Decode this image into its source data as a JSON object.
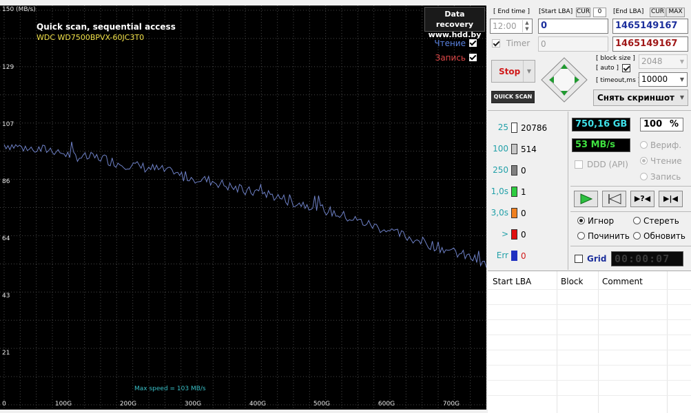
{
  "graph": {
    "y_labels": [
      {
        "text": "150 (MB/s)",
        "y": 15
      },
      {
        "text": "129",
        "y": 99
      },
      {
        "text": "107",
        "y": 182
      },
      {
        "text": "86",
        "y": 265
      },
      {
        "text": "64",
        "y": 348
      },
      {
        "text": "43",
        "y": 431
      },
      {
        "text": "21",
        "y": 514
      }
    ],
    "x_labels": [
      {
        "text": "0",
        "x": 6
      },
      {
        "text": "100G",
        "x": 92
      },
      {
        "text": "200G",
        "x": 186
      },
      {
        "text": "300G",
        "x": 280
      },
      {
        "text": "400G",
        "x": 374
      },
      {
        "text": "500G",
        "x": 467
      },
      {
        "text": "600G",
        "x": 561
      },
      {
        "text": "700G",
        "x": 655
      }
    ],
    "title": "Quick scan, sequential access",
    "model": "WDC WD7500BPVX-60JC3T0",
    "brand_line1": "Data recovery",
    "brand_line2": "www.hdd.by",
    "legend_read": "Чтение",
    "legend_write": "Запись",
    "max_speed": "Max speed = 103 MB/s",
    "colors": {
      "line": "#6f82c8",
      "grid": "#4a4a4a"
    }
  },
  "chart_data": {
    "type": "line",
    "title": "Quick scan, sequential access",
    "ylabel": "MB/s",
    "xlabel": "",
    "xlim": [
      0,
      750
    ],
    "ylim": [
      0,
      150
    ],
    "x_ticks": [
      "0",
      "100G",
      "200G",
      "300G",
      "400G",
      "500G",
      "600G",
      "700G"
    ],
    "y_ticks": [
      "21",
      "43",
      "64",
      "86",
      "107",
      "129",
      "150 (MB/s)"
    ],
    "series": [
      {
        "name": "Чтение",
        "x": [
          0,
          25,
          50,
          75,
          100,
          125,
          150,
          175,
          200,
          225,
          250,
          275,
          300,
          325,
          350,
          375,
          400,
          425,
          450,
          475,
          500,
          525,
          550,
          575,
          600,
          625,
          650,
          675,
          700,
          725,
          750
        ],
        "values": [
          99,
          98,
          97,
          97,
          95,
          94,
          94,
          92,
          91,
          90,
          89,
          87,
          86,
          85,
          83,
          81,
          81,
          79,
          77,
          76,
          74,
          72,
          70,
          68,
          66,
          64,
          62,
          60,
          58,
          56,
          53
        ]
      }
    ]
  },
  "panel": {
    "end_time_label": "[ End time ]",
    "end_time_value": "12:00",
    "timer_label": "Timer",
    "start_lba_label": "[Start LBA]",
    "cur_label": "CUR",
    "cur_value": "0",
    "start_lba_value": "0",
    "start_lba_disabled": "0",
    "end_lba_label": "[End LBA]",
    "end_cur": "CUR",
    "end_max": "MAX",
    "end_lba_value": "1465149167",
    "end_lba_value2": "1465149167",
    "stop_label": "Stop",
    "quick_scan_label": "QUICK SCAN",
    "block_size_label": "[ block size ]",
    "auto_label": "[ auto ]",
    "block_size_value": "2048",
    "timeout_label": "[ timeout,ms ]",
    "timeout_value": "10000",
    "screenshot_label": "Снять скриншот",
    "stats": [
      {
        "label": "25",
        "count": "20786",
        "color": "#ffffff",
        "label_color": "#21a0a8"
      },
      {
        "label": "100",
        "count": "514",
        "color": "#c8c8c8",
        "label_color": "#21a0a8"
      },
      {
        "label": "250",
        "count": "0",
        "color": "#808080",
        "label_color": "#21a0a8"
      },
      {
        "label": "1,0s",
        "count": "1",
        "color": "#2ecc40",
        "label_color": "#21a0a8"
      },
      {
        "label": "3,0s",
        "count": "0",
        "color": "#f08020",
        "label_color": "#21a0a8"
      },
      {
        "label": ">",
        "count": "0",
        "color": "#e01010",
        "label_color": "#21a0a8"
      },
      {
        "label": "Err",
        "count": "0",
        "color": "#2030c0",
        "label_color": "#21a0a8"
      }
    ],
    "capacity": "750,16 GB",
    "percent_value": "100",
    "percent_sign": "%",
    "speed": "53 MB/s",
    "verify_label": "Вериф.",
    "read_label": "Чтение",
    "write_label": "Запись",
    "ddd_label": "DDD (API)",
    "action_ignore": "Игнор",
    "action_erase": "Стереть",
    "action_repair": "Починить",
    "action_refresh": "Обновить",
    "grid_label": "Grid",
    "elapsed": "00:00:07",
    "table_headers": [
      "Start LBA",
      "Block",
      "Comment"
    ]
  }
}
